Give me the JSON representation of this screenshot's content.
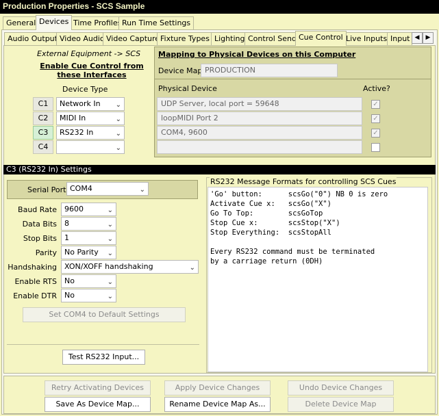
{
  "window": {
    "title": "Production Properties - SCS Sample"
  },
  "top_tabs": [
    {
      "label": "General"
    },
    {
      "label": "Devices"
    },
    {
      "label": "Time Profiles"
    },
    {
      "label": "Run Time Settings"
    }
  ],
  "sub_tabs": [
    {
      "label": "Audio Output"
    },
    {
      "label": "Video Audio"
    },
    {
      "label": "Video Capture"
    },
    {
      "label": "Fixture Types"
    },
    {
      "label": "Lighting"
    },
    {
      "label": "Control Send"
    },
    {
      "label": "Cue Control"
    },
    {
      "label": "Live Inputs"
    },
    {
      "label": "Input G"
    }
  ],
  "left": {
    "ext_label": "External Equipment -> SCS",
    "enable_line1": "Enable Cue Control from",
    "enable_line2": "these Interfaces",
    "device_type_label": "Device Type",
    "rows": [
      {
        "code": "C1",
        "type": "Network In"
      },
      {
        "code": "C2",
        "type": "MIDI In"
      },
      {
        "code": "C3",
        "type": "RS232 In"
      },
      {
        "code": "C4",
        "type": ""
      }
    ]
  },
  "mapping": {
    "title": "Mapping to Physical Devices on this Computer",
    "device_map_label": "Device Map",
    "device_map_value": "PRODUCTION",
    "physical_device_label": "Physical Device",
    "active_label": "Active?",
    "devices": [
      {
        "name": "UDP Server, local port = 59648",
        "active": "✓"
      },
      {
        "name": "loopMIDI Port 2",
        "active": "✓"
      },
      {
        "name": "COM4, 9600",
        "active": "✓"
      },
      {
        "name": "",
        "active": ""
      }
    ]
  },
  "settings": {
    "header": "C3 (RS232 In) Settings",
    "serial_port_label": "Serial Port",
    "serial_port_value": "COM4",
    "fields": [
      {
        "label": "Baud Rate",
        "value": "9600"
      },
      {
        "label": "Data Bits",
        "value": "8"
      },
      {
        "label": "Stop Bits",
        "value": "1"
      },
      {
        "label": "Parity",
        "value": "No Parity"
      },
      {
        "label": "Handshaking",
        "value": "XON/XOFF handshaking"
      },
      {
        "label": "Enable RTS",
        "value": "No"
      },
      {
        "label": "Enable DTR",
        "value": "No"
      }
    ],
    "default_button": "Set COM4 to Default Settings",
    "test_button": "Test RS232 Input..."
  },
  "formats": {
    "title": "RS232 Message Formats for controlling SCS Cues",
    "lines": [
      "'Go' button:      scsGo(\"0\") NB 0 is zero",
      "Activate Cue x:   scsGo(\"X\")",
      "Go To Top:        scsGoTop",
      "Stop Cue x:       scsStop(\"X\")",
      "Stop Everything:  scsStopAll",
      "",
      "Every RS232 command must be terminated",
      "by a carriage return (0DH)"
    ]
  },
  "bottom": {
    "retry": "Retry Activating Devices",
    "apply": "Apply Device Changes",
    "undo": "Undo Device Changes",
    "save": "Save As Device Map...",
    "rename": "Rename Device Map As...",
    "delete": "Delete Device Map"
  },
  "colors": {
    "panel_bg": "#f5f5c3",
    "mapping_bg": "#d8d8a4",
    "header_bg": "#000000"
  },
  "icons": {
    "scroll_left": "◀",
    "scroll_right": "▶",
    "chevron": "⌄"
  }
}
